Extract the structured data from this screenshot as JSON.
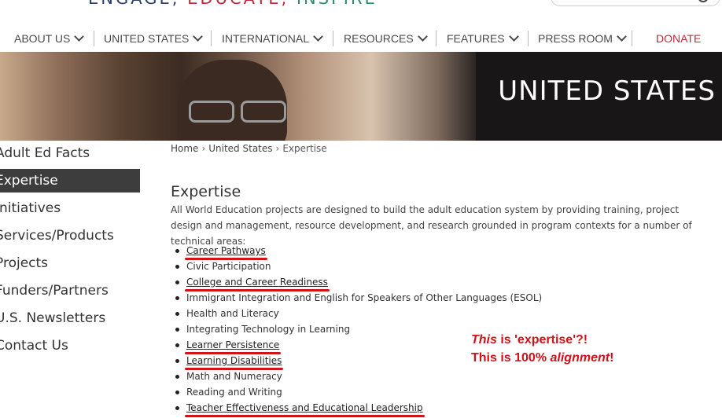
{
  "header": {
    "tagline_1": "ENGAGE,",
    "tagline_2": "EDUCATE,",
    "tagline_3": "INSPIRE"
  },
  "nav": {
    "items": [
      {
        "label": "ABOUT US"
      },
      {
        "label": "UNITED STATES"
      },
      {
        "label": "INTERNATIONAL"
      },
      {
        "label": "RESOURCES"
      },
      {
        "label": "FEATURES"
      },
      {
        "label": "PRESS ROOM"
      }
    ],
    "donate_label": "DONATE"
  },
  "banner": {
    "title": "UNITED STATES"
  },
  "sidebar": {
    "items": [
      {
        "label": "Adult Ed Facts"
      },
      {
        "label": "Expertise"
      },
      {
        "label": "Initiatives"
      },
      {
        "label": "Services/Products"
      },
      {
        "label": "Projects"
      },
      {
        "label": "Funders/Partners"
      },
      {
        "label": "U.S. Newsletters"
      },
      {
        "label": "Contact Us"
      }
    ]
  },
  "breadcrumb": {
    "home": "Home",
    "section": "United States",
    "current": "Expertise"
  },
  "main": {
    "title": "Expertise",
    "intro": "All World Education projects are designed to build the adult education system by providing training, project design and management, resource development, and research grounded in program contexts for a number of technical areas:",
    "areas": [
      {
        "label": "Career Pathways",
        "highlighted": true
      },
      {
        "label": "Civic Participation",
        "highlighted": false
      },
      {
        "label": "College and Career Readiness",
        "highlighted": true
      },
      {
        "label": "Immigrant Integration and English for Speakers of Other Languages (ESOL)",
        "highlighted": false
      },
      {
        "label": "Health and Literacy",
        "highlighted": false
      },
      {
        "label": "Integrating Technology in Learning",
        "highlighted": false
      },
      {
        "label": "Learner Persistence",
        "highlighted": true
      },
      {
        "label": "Learning Disabilities",
        "highlighted": true
      },
      {
        "label": "Math and Numeracy",
        "highlighted": false
      },
      {
        "label": "Reading and Writing",
        "highlighted": false
      },
      {
        "label": "Teacher Effectiveness and Educational Leadership",
        "highlighted": true
      }
    ]
  },
  "annotation": {
    "line1_italic": "This",
    "line1_rest": " is 'expertise'?!",
    "line2_start": "This is 100% ",
    "line2_italic": "alignment",
    "line2_end": "!"
  },
  "colors": {
    "accent_red": "#c0283c",
    "annotation_red": "#d0121b",
    "sidebar_active": "#3d3d3d"
  }
}
